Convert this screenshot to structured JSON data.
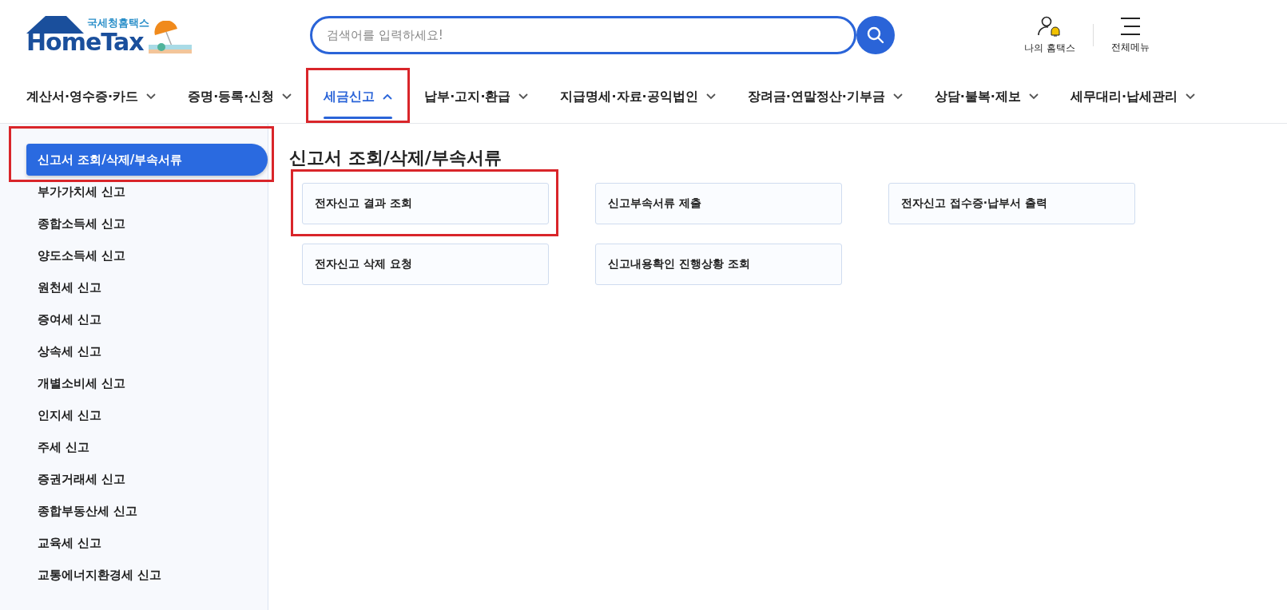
{
  "logo": {
    "subtitle": "국세청홈택스",
    "title": "HomeTax"
  },
  "search": {
    "placeholder": "검색어를 입력하세요!"
  },
  "header_links": [
    {
      "kind": "my",
      "label": "나의 홈택스"
    },
    {
      "kind": "menu",
      "label": "전체메뉴"
    }
  ],
  "nav": [
    {
      "label": "계산서·영수증·카드",
      "selected": false,
      "highlighted": false
    },
    {
      "label": "증명·등록·신청",
      "selected": false,
      "highlighted": false
    },
    {
      "label": "세금신고",
      "selected": true,
      "highlighted": true
    },
    {
      "label": "납부·고지·환급",
      "selected": false,
      "highlighted": false
    },
    {
      "label": "지급명세·자료·공익법인",
      "selected": false,
      "highlighted": false
    },
    {
      "label": "장려금·연말정산·기부금",
      "selected": false,
      "highlighted": false
    },
    {
      "label": "상담·불복·제보",
      "selected": false,
      "highlighted": false
    },
    {
      "label": "세무대리·납세관리",
      "selected": false,
      "highlighted": false
    }
  ],
  "sidebar": {
    "items": [
      {
        "label": "신고서 조회/삭제/부속서류",
        "selected": true,
        "highlighted": true
      },
      {
        "label": "부가가치세 신고",
        "selected": false,
        "highlighted": false
      },
      {
        "label": "종합소득세 신고",
        "selected": false,
        "highlighted": false
      },
      {
        "label": "양도소득세 신고",
        "selected": false,
        "highlighted": false
      },
      {
        "label": "원천세 신고",
        "selected": false,
        "highlighted": false
      },
      {
        "label": "증여세 신고",
        "selected": false,
        "highlighted": false
      },
      {
        "label": "상속세 신고",
        "selected": false,
        "highlighted": false
      },
      {
        "label": "개별소비세 신고",
        "selected": false,
        "highlighted": false
      },
      {
        "label": "인지세 신고",
        "selected": false,
        "highlighted": false
      },
      {
        "label": "주세 신고",
        "selected": false,
        "highlighted": false
      },
      {
        "label": "증권거래세 신고",
        "selected": false,
        "highlighted": false
      },
      {
        "label": "종합부동산세 신고",
        "selected": false,
        "highlighted": false
      },
      {
        "label": "교육세 신고",
        "selected": false,
        "highlighted": false
      },
      {
        "label": "교통에너지환경세 신고",
        "selected": false,
        "highlighted": false
      }
    ]
  },
  "content": {
    "title": "신고서 조회/삭제/부속서류",
    "cards": [
      {
        "label": "전자신고 결과 조회",
        "highlighted": true
      },
      {
        "label": "신고부속서류 제출",
        "highlighted": false
      },
      {
        "label": "전자신고 접수증·납부서 출력",
        "highlighted": false
      },
      {
        "label": "전자신고 삭제 요청",
        "highlighted": false
      },
      {
        "label": "신고내용확인 진행상황 조회",
        "highlighted": false
      }
    ]
  }
}
